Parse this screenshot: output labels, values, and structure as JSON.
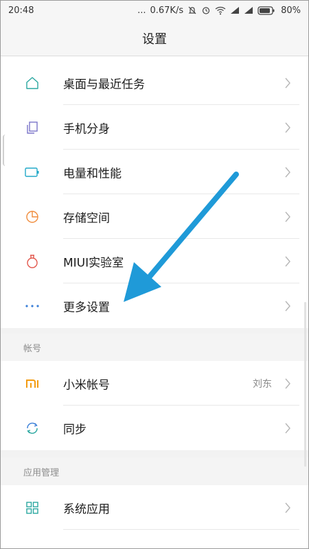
{
  "status_bar": {
    "time": "20:48",
    "dots": "...",
    "speed": "0.67K/s",
    "battery": "80%"
  },
  "header": {
    "title": "设置"
  },
  "settings": [
    {
      "label": "桌面与最近任务",
      "icon": "home-icon"
    },
    {
      "label": "手机分身",
      "icon": "dual-app-icon"
    },
    {
      "label": "电量和性能",
      "icon": "battery-icon"
    },
    {
      "label": "存储空间",
      "icon": "storage-pie-icon"
    },
    {
      "label": "MIUI实验室",
      "icon": "lab-flask-icon"
    },
    {
      "label": "更多设置",
      "icon": "more-dots-icon"
    }
  ],
  "account_section": {
    "title": "帐号",
    "items": [
      {
        "label": "小米帐号",
        "value": "刘东",
        "icon": "mi-logo-icon"
      },
      {
        "label": "同步",
        "icon": "sync-icon"
      }
    ]
  },
  "apps_section": {
    "title": "应用管理",
    "items": [
      {
        "label": "系统应用",
        "icon": "grid-apps-icon"
      }
    ]
  },
  "colors": {
    "icon_teal": "#2aa7a0",
    "icon_purple": "#7a74c9",
    "icon_cyan": "#21a8c8",
    "icon_orange": "#f08c3c",
    "icon_red": "#e2574c",
    "icon_blue": "#3a7fd8",
    "mi_orange": "#f39c12",
    "arrow_blue": "#1f9ad8"
  }
}
